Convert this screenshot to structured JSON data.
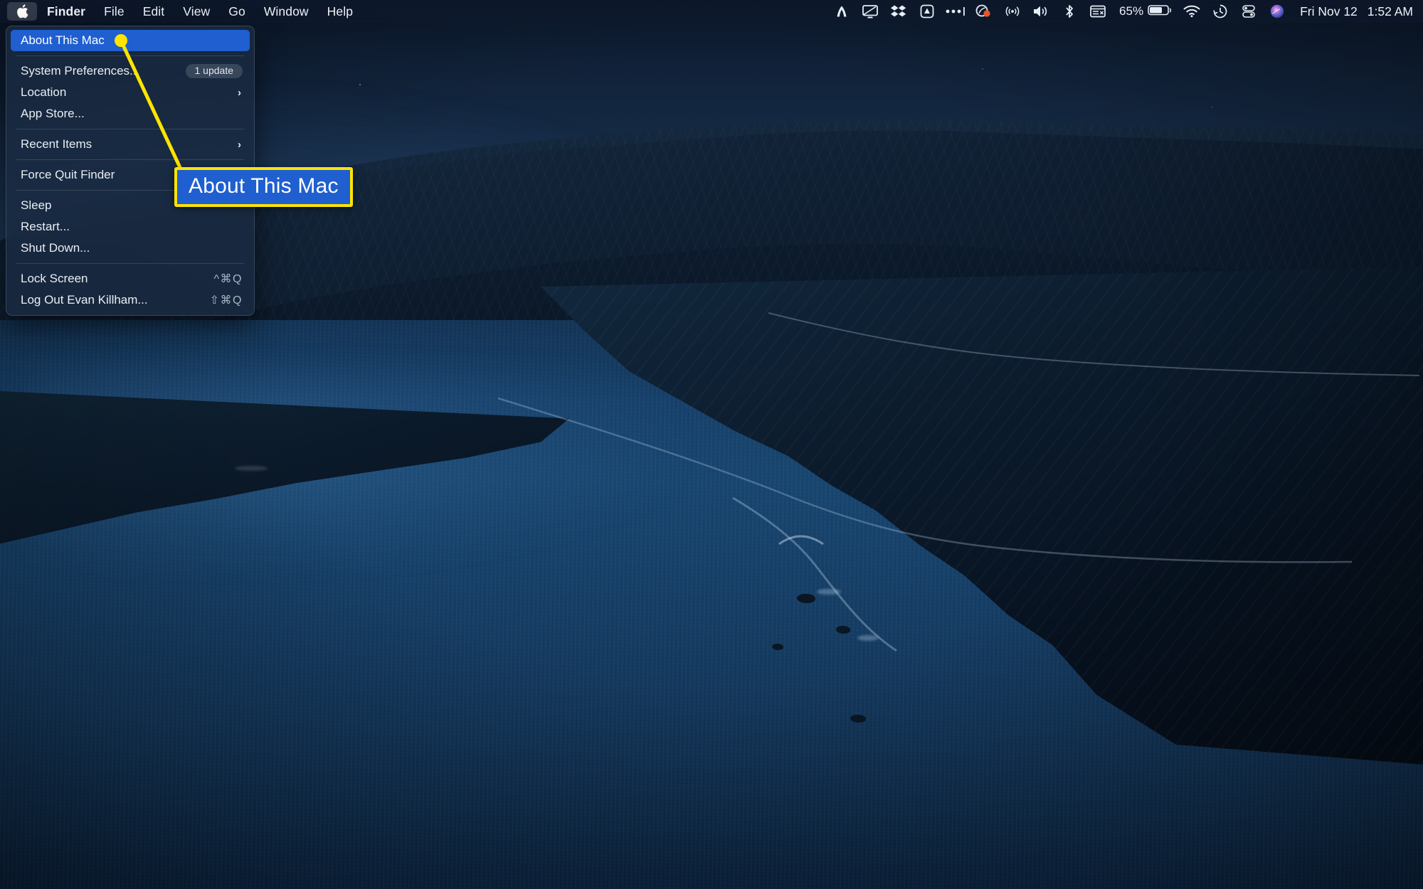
{
  "desktop": {
    "wallpaper_name": "big-sur-coastline-night",
    "colors": {
      "sky_top": "#0b1628",
      "sky_bottom": "#21415f",
      "ocean": "#16406a",
      "ridge": "#12243a",
      "accent_blue": "#1f5fd0",
      "annotation_yellow": "#ffe400",
      "menubar_bg": "rgba(14,26,45,0.62)",
      "menu_bg": "rgba(26,43,66,0.82)"
    }
  },
  "menubar": {
    "apple_logo": "apple-logo-icon",
    "app_menus": [
      {
        "label": "Finder",
        "bold": true
      },
      {
        "label": "File",
        "bold": false
      },
      {
        "label": "Edit",
        "bold": false
      },
      {
        "label": "View",
        "bold": false
      },
      {
        "label": "Go",
        "bold": false
      },
      {
        "label": "Window",
        "bold": false
      },
      {
        "label": "Help",
        "bold": false
      }
    ],
    "status_icons": [
      {
        "name": "nordvpn-icon"
      },
      {
        "name": "screen-sharing-icon"
      },
      {
        "name": "dropbox-icon"
      },
      {
        "name": "backblaze-icon"
      },
      {
        "name": "overflow-dots-icon"
      },
      {
        "name": "screen-recording-icon"
      },
      {
        "name": "airplay-broadcast-icon"
      },
      {
        "name": "volume-icon"
      },
      {
        "name": "bluetooth-icon"
      },
      {
        "name": "window-manager-icon"
      }
    ],
    "battery": {
      "percent_label": "65%",
      "level": 65,
      "icon": "battery-icon"
    },
    "right_icons": [
      {
        "name": "wifi-icon"
      },
      {
        "name": "time-machine-icon"
      },
      {
        "name": "control-center-icon"
      },
      {
        "name": "siri-icon"
      }
    ],
    "clock": {
      "date": "Fri Nov 12",
      "time": "1:52 AM"
    }
  },
  "apple_menu": {
    "items": [
      {
        "type": "item",
        "label": "About This Mac",
        "selected": true,
        "badge": null,
        "shortcut": null,
        "submenu": false
      },
      {
        "type": "separator"
      },
      {
        "type": "item",
        "label": "System Preferences...",
        "selected": false,
        "badge": "1 update",
        "shortcut": null,
        "submenu": false
      },
      {
        "type": "item",
        "label": "Location",
        "selected": false,
        "badge": null,
        "shortcut": null,
        "submenu": true
      },
      {
        "type": "item",
        "label": "App Store...",
        "selected": false,
        "badge": null,
        "shortcut": null,
        "submenu": false
      },
      {
        "type": "separator"
      },
      {
        "type": "item",
        "label": "Recent Items",
        "selected": false,
        "badge": null,
        "shortcut": null,
        "submenu": true
      },
      {
        "type": "separator"
      },
      {
        "type": "item",
        "label": "Force Quit Finder",
        "selected": false,
        "badge": null,
        "shortcut": null,
        "submenu": false
      },
      {
        "type": "separator"
      },
      {
        "type": "item",
        "label": "Sleep",
        "selected": false,
        "badge": null,
        "shortcut": null,
        "submenu": false
      },
      {
        "type": "item",
        "label": "Restart...",
        "selected": false,
        "badge": null,
        "shortcut": null,
        "submenu": false
      },
      {
        "type": "item",
        "label": "Shut Down...",
        "selected": false,
        "badge": null,
        "shortcut": null,
        "submenu": false
      },
      {
        "type": "separator"
      },
      {
        "type": "item",
        "label": "Lock Screen",
        "selected": false,
        "badge": null,
        "shortcut": "^⌘Q",
        "submenu": false
      },
      {
        "type": "item",
        "label": "Log Out Evan Killham...",
        "selected": false,
        "badge": null,
        "shortcut": "⇧⌘Q",
        "submenu": false
      }
    ]
  },
  "annotation": {
    "callout_label": "About This Mac",
    "marker_dot": "callout-anchor-dot",
    "line": "callout-leader-line"
  }
}
